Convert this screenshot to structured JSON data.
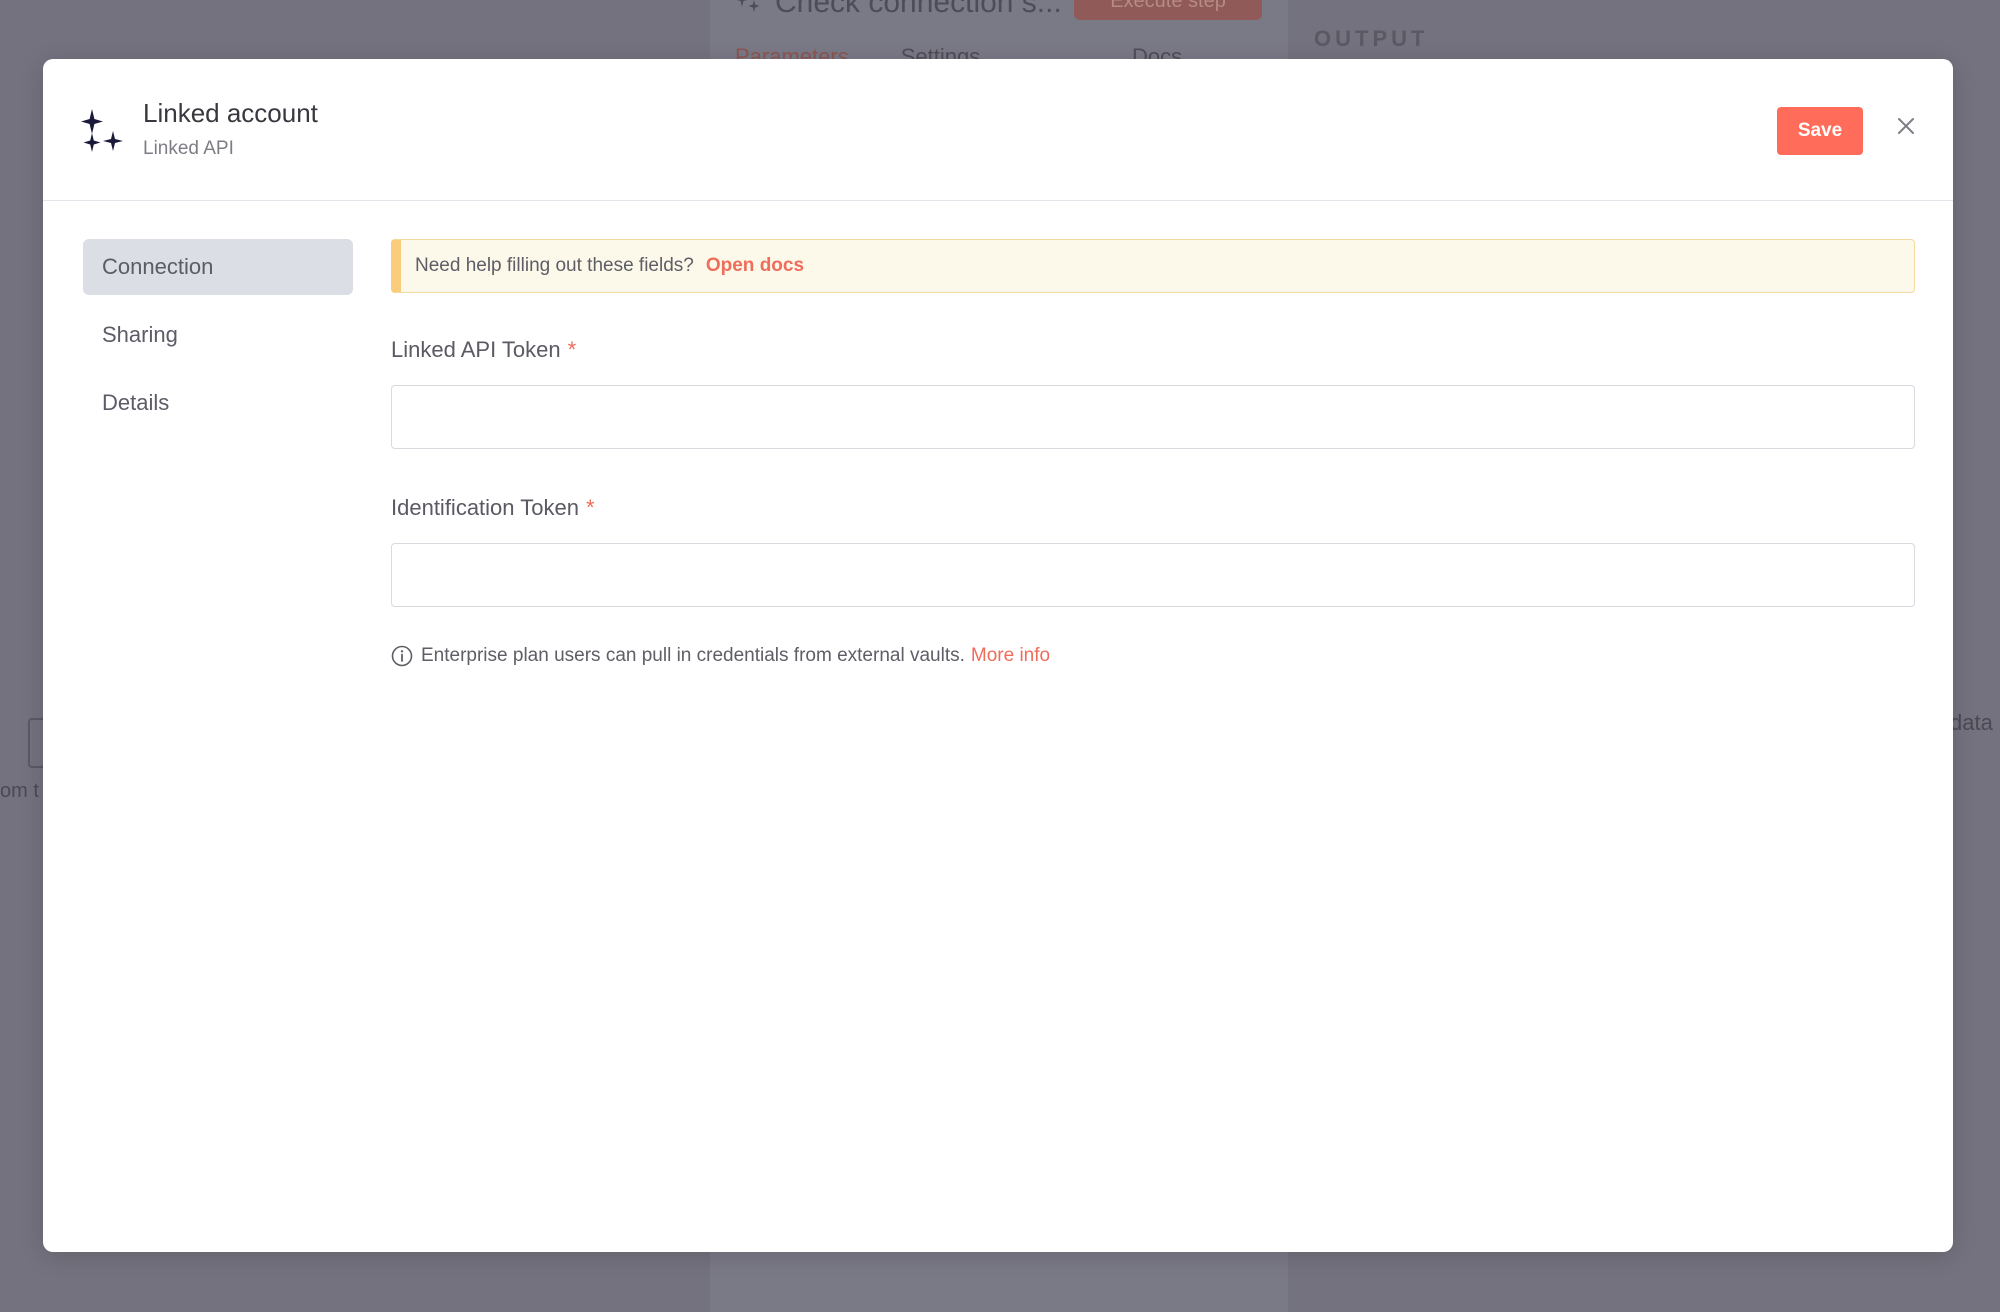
{
  "background": {
    "panel_title": "Check connection s...",
    "execute_button": "Execute step",
    "tabs": [
      "Parameters",
      "Settings"
    ],
    "docs_label": "Docs",
    "output_label": "OUTPUT",
    "left_fragment": "om t",
    "right_fragment": "data"
  },
  "modal": {
    "title": "Linked account",
    "subtitle": "Linked API",
    "icon": "sparkles-icon",
    "save_label": "Save",
    "close_icon": "close-icon"
  },
  "sidebar": {
    "items": [
      {
        "label": "Connection",
        "active": true
      },
      {
        "label": "Sharing",
        "active": false
      },
      {
        "label": "Details",
        "active": false
      }
    ]
  },
  "form": {
    "help_text": "Need help filling out these fields?",
    "help_link": "Open docs",
    "fields": [
      {
        "label": "Linked API Token",
        "required_mark": "*",
        "value": "",
        "placeholder": ""
      },
      {
        "label": "Identification Token",
        "required_mark": "*",
        "value": "",
        "placeholder": ""
      }
    ],
    "info_text": "Enterprise plan users can pull in credentials from external vaults.",
    "info_link": "More info",
    "info_icon": "info-circle-icon"
  },
  "colors": {
    "accent": "#ff6d5a",
    "link": "#ee6d5b",
    "banner_bg": "#fcf8ea",
    "banner_border": "#f9cd7b",
    "active_nav_bg": "#dbdee5",
    "overlay": "#73727e"
  }
}
